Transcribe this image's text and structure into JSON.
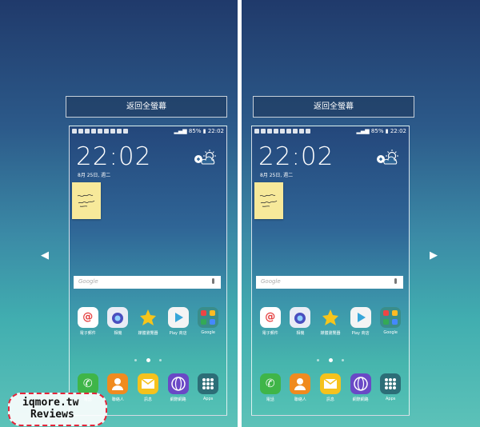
{
  "panels": [
    {
      "fullscreen_label": "返回全螢幕",
      "nav_arrow": "◀",
      "status": {
        "battery": "85%",
        "time": "22:02"
      },
      "clock": "22:02",
      "date": "8月 25日, 週二",
      "search_placeholder": "Google",
      "apps": [
        {
          "label": "電子郵件",
          "color": "#ffffff",
          "icon": "email-icon"
        },
        {
          "label": "相機",
          "color": "#e9ecf5",
          "icon": "camera-icon"
        },
        {
          "label": "媒體瀏覽器",
          "color": "transparent",
          "icon": "gallery-icon"
        },
        {
          "label": "Play 商店",
          "color": "#f4f4f4",
          "icon": "play-store-icon"
        },
        {
          "label": "Google",
          "color": "#3a8d8a",
          "icon": "google-folder-icon"
        }
      ],
      "dock": [
        {
          "label": "電話",
          "color": "#3fb548",
          "icon": "phone-icon"
        },
        {
          "label": "聯絡人",
          "color": "#f08b1f",
          "icon": "contacts-icon"
        },
        {
          "label": "訊息",
          "color": "#f5c21d",
          "icon": "messages-icon"
        },
        {
          "label": "網際網路",
          "color": "#6a49c6",
          "icon": "internet-icon"
        },
        {
          "label": "Apps",
          "color": "#2c6e77",
          "icon": "apps-icon"
        }
      ]
    },
    {
      "fullscreen_label": "返回全螢幕",
      "nav_arrow": "▶",
      "status": {
        "battery": "85%",
        "time": "22:02"
      },
      "clock": "22:02",
      "date": "8月 25日, 週二",
      "search_placeholder": "Google",
      "apps": [
        {
          "label": "電子郵件",
          "color": "#ffffff",
          "icon": "email-icon"
        },
        {
          "label": "相機",
          "color": "#e9ecf5",
          "icon": "camera-icon"
        },
        {
          "label": "媒體瀏覽器",
          "color": "transparent",
          "icon": "gallery-icon"
        },
        {
          "label": "Play 商店",
          "color": "#f4f4f4",
          "icon": "play-store-icon"
        },
        {
          "label": "Google",
          "color": "#3a8d8a",
          "icon": "google-folder-icon"
        }
      ],
      "dock": [
        {
          "label": "電話",
          "color": "#3fb548",
          "icon": "phone-icon"
        },
        {
          "label": "聯絡人",
          "color": "#f08b1f",
          "icon": "contacts-icon"
        },
        {
          "label": "訊息",
          "color": "#f5c21d",
          "icon": "messages-icon"
        },
        {
          "label": "網際網路",
          "color": "#6a49c6",
          "icon": "internet-icon"
        },
        {
          "label": "Apps",
          "color": "#2c6e77",
          "icon": "apps-icon"
        }
      ]
    }
  ],
  "watermark": {
    "line1": "iqmore.tw",
    "line2": "Reviews"
  }
}
